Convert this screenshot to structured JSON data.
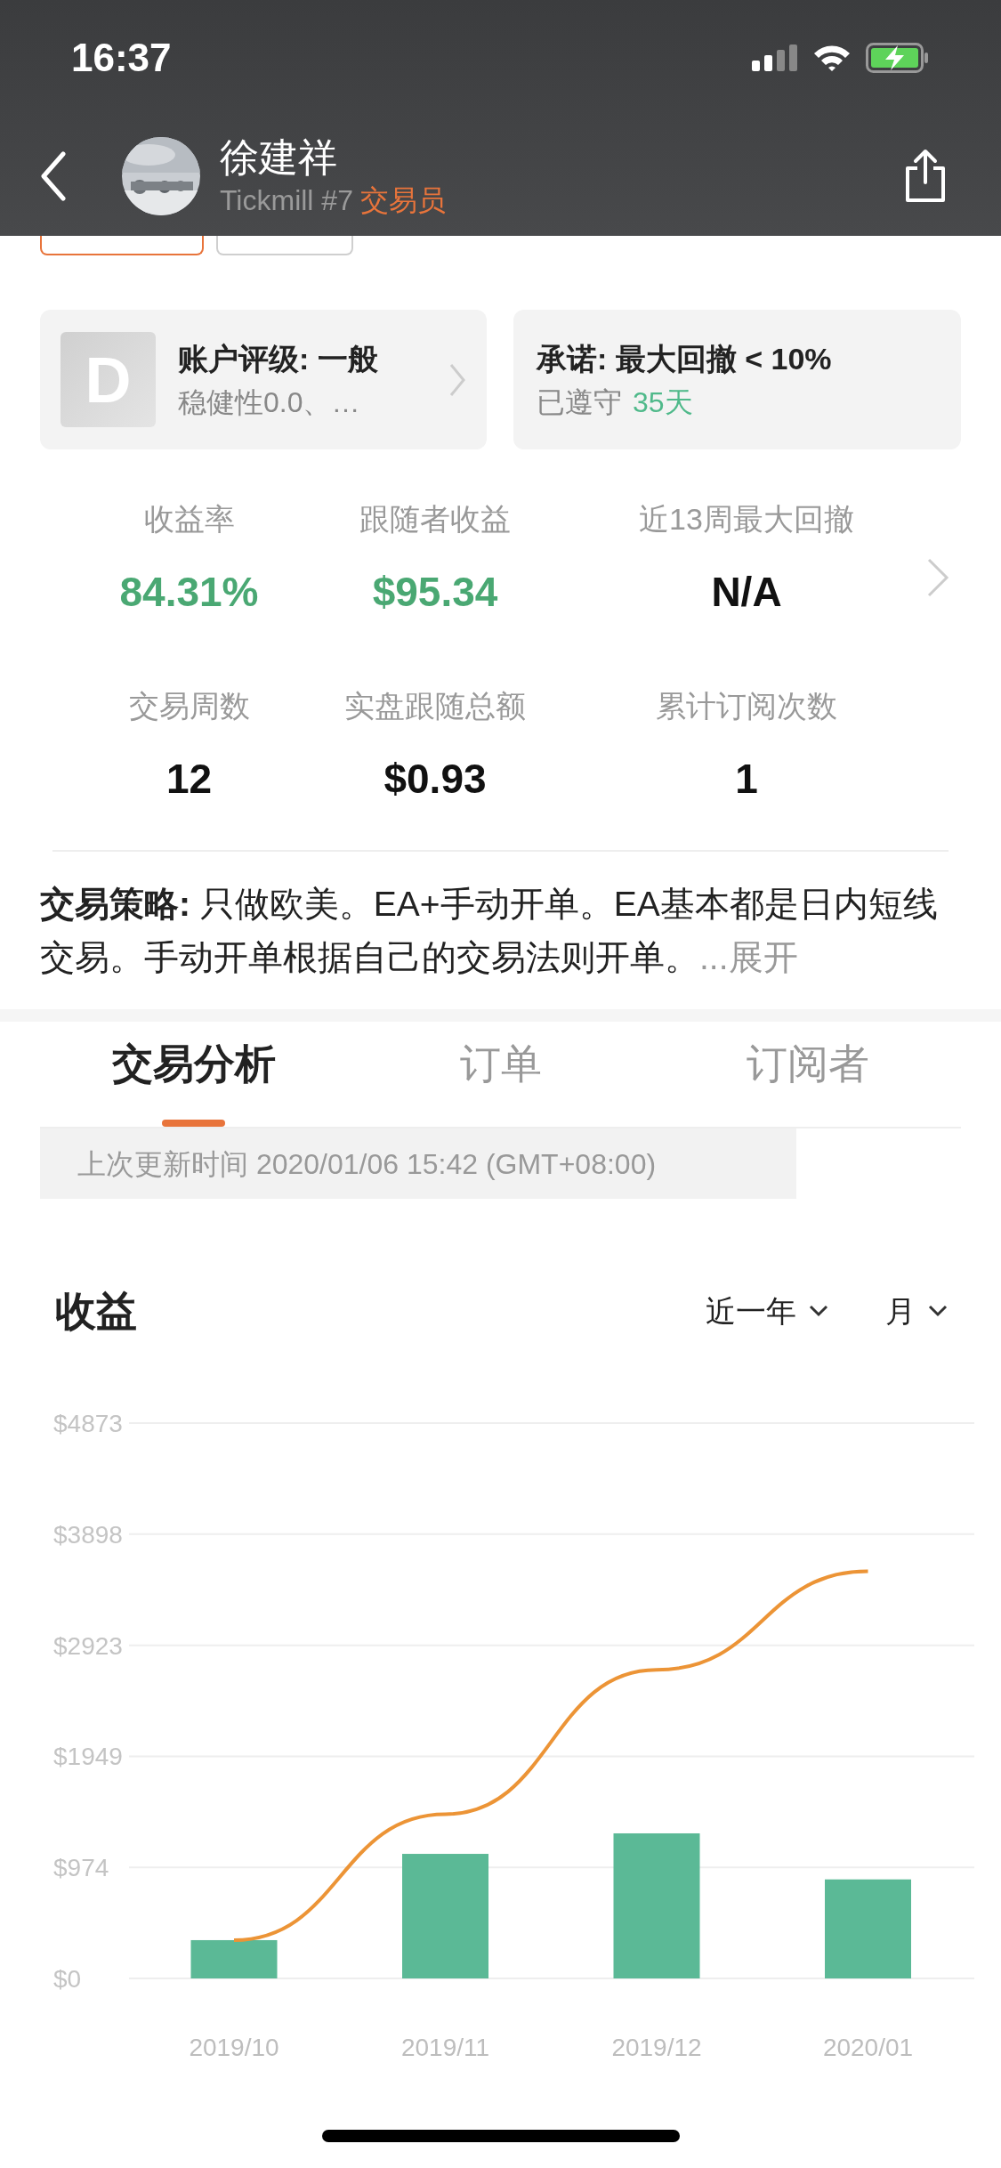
{
  "status_bar": {
    "time": "16:37"
  },
  "header": {
    "name": "徐建祥",
    "broker": "Tickmill #7",
    "role": "交易员"
  },
  "tags": [
    {
      "kind": "orange"
    },
    {
      "kind": "gray"
    }
  ],
  "rating_card": {
    "grade": "D",
    "title": "账户评级: 一般",
    "subtitle": "稳健性0.0、…"
  },
  "promise_card": {
    "title": "承诺: 最大回撤 < 10%",
    "status": "已遵守",
    "days": "35天"
  },
  "stats": [
    {
      "label": "收益率",
      "value": "84.31%",
      "kind": "positive"
    },
    {
      "label": "跟随者收益",
      "value": "$95.34",
      "kind": "positive"
    },
    {
      "label": "近13周最大回撤",
      "value": "N/A",
      "kind": "neutral"
    },
    {
      "label": "交易周数",
      "value": "12",
      "kind": "neutral"
    },
    {
      "label": "实盘跟随总额",
      "value": "$0.93",
      "kind": "neutral"
    },
    {
      "label": "累计订阅次数",
      "value": "1",
      "kind": "neutral"
    }
  ],
  "strategy": {
    "text": "**交易策略:** 只做欧美。EA+手动开单。EA基本都是日内短线交易。手动开单根据自己的交易法则开单。",
    "more": "...展开"
  },
  "tabs": [
    {
      "label": "交易分析",
      "selected": true
    },
    {
      "label": "订单",
      "selected": false
    },
    {
      "label": "订阅者",
      "selected": false
    }
  ],
  "update_time": "上次更新时间 2020/01/06 15:42 (GMT+08:00)",
  "earnings": {
    "title": "收益",
    "filters": [
      "近一年",
      "月"
    ],
    "chart_data": {
      "type": "bar",
      "categories": [
        "2019/10",
        "2019/11",
        "2019/12",
        "2020/01"
      ],
      "series": [
        {
          "color": "#5bb996",
          "values": [
            336,
            1093,
            1273,
            869
          ]
        },
        {
          "type": "line",
          "color": "#ec9436",
          "values": [
            336,
            1441,
            2708,
            3572
          ]
        }
      ],
      "ylim": [
        0,
        4873
      ],
      "grid": true,
      "yticks": [
        {
          "value": 0,
          "label": "$0"
        },
        {
          "value": 974,
          "label": "$974"
        },
        {
          "value": 1949,
          "label": "$1949"
        },
        {
          "value": 2923,
          "label": "$2923"
        },
        {
          "value": 3898,
          "label": "$3898"
        },
        {
          "value": 4873,
          "label": "$4873"
        }
      ]
    }
  }
}
